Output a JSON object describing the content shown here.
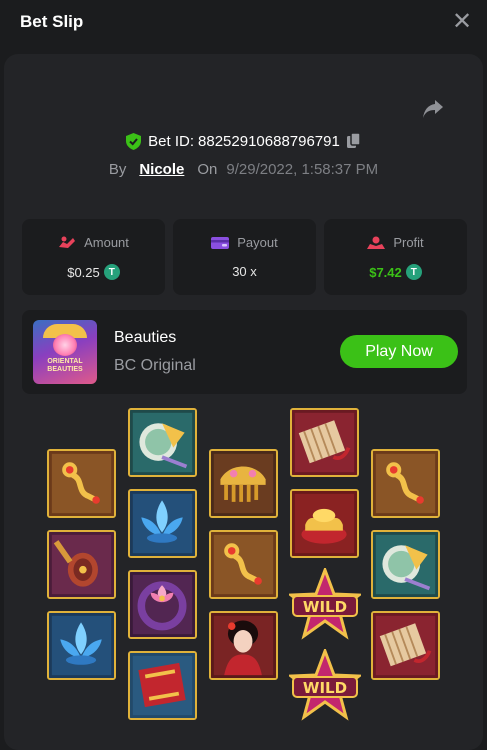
{
  "header": {
    "title": "Bet Slip"
  },
  "bet": {
    "id_label": "Bet ID:",
    "id": "88252910688796791",
    "by_label": "By",
    "user": "Nicole",
    "on_label": "On",
    "date": "9/29/2022, 1:58:37 PM"
  },
  "stats": {
    "amount": {
      "label": "Amount",
      "value": "$0.25"
    },
    "payout": {
      "label": "Payout",
      "value": "30 x"
    },
    "profit": {
      "label": "Profit",
      "value": "$7.42"
    }
  },
  "currency_icon": "tether-coin-icon",
  "game": {
    "name": "Beauties",
    "provider": "BC Original",
    "thumb_text": "ORIENTAL BEAUTIES",
    "play_label": "Play Now"
  },
  "reels": [
    [
      "golden-hairpin",
      "lute",
      "blue-lotus"
    ],
    [
      "jade-fan",
      "blue-lotus",
      "lotus-bracelet",
      "red-scroll"
    ],
    [
      "golden-comb",
      "golden-hairpin",
      "beauty-lady"
    ],
    [
      "bamboo-scroll",
      "gold-ingots",
      "wild-star",
      "wild-star"
    ],
    [
      "golden-hairpin",
      "jade-fan",
      "bamboo-scroll"
    ]
  ],
  "wild_label": "WILD",
  "colors": {
    "accent_green": "#3bc117",
    "tile_border": "#e0b23a",
    "panel": "#232427",
    "card": "#1b1c1e"
  }
}
